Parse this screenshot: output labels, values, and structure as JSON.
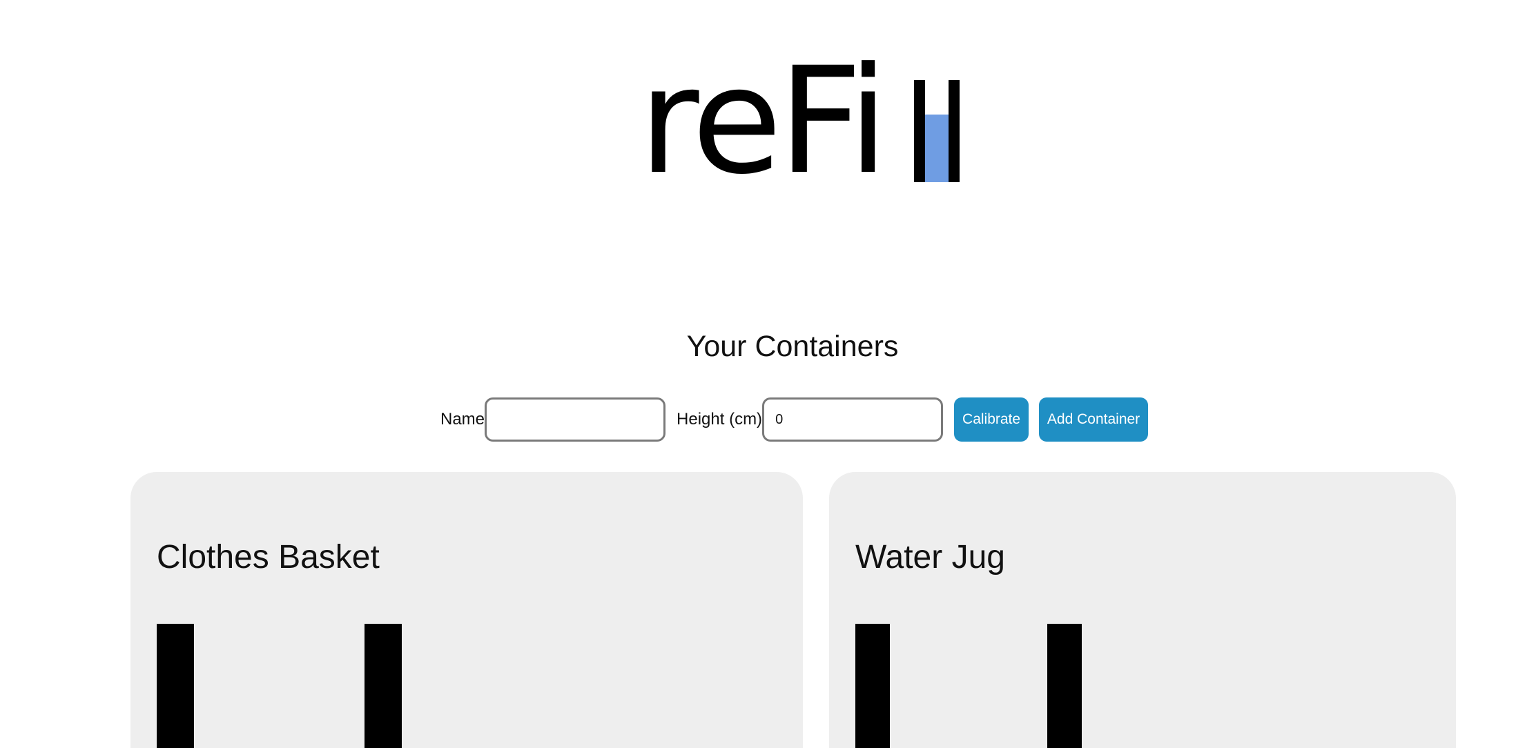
{
  "logo": {
    "text": "reFi",
    "fill_level": 0.66,
    "water_color": "#6f9de3"
  },
  "section": {
    "title": "Your Containers"
  },
  "form": {
    "name_label": "Name",
    "name_value": "",
    "height_label": "Height (cm)",
    "height_value": "0",
    "calibrate_label": "Calibrate",
    "add_label": "Add Container"
  },
  "colors": {
    "accent": "#1f8fc4",
    "card_background": "#eeeeee"
  },
  "containers": [
    {
      "name": "Clothes Basket"
    },
    {
      "name": "Water Jug"
    }
  ]
}
